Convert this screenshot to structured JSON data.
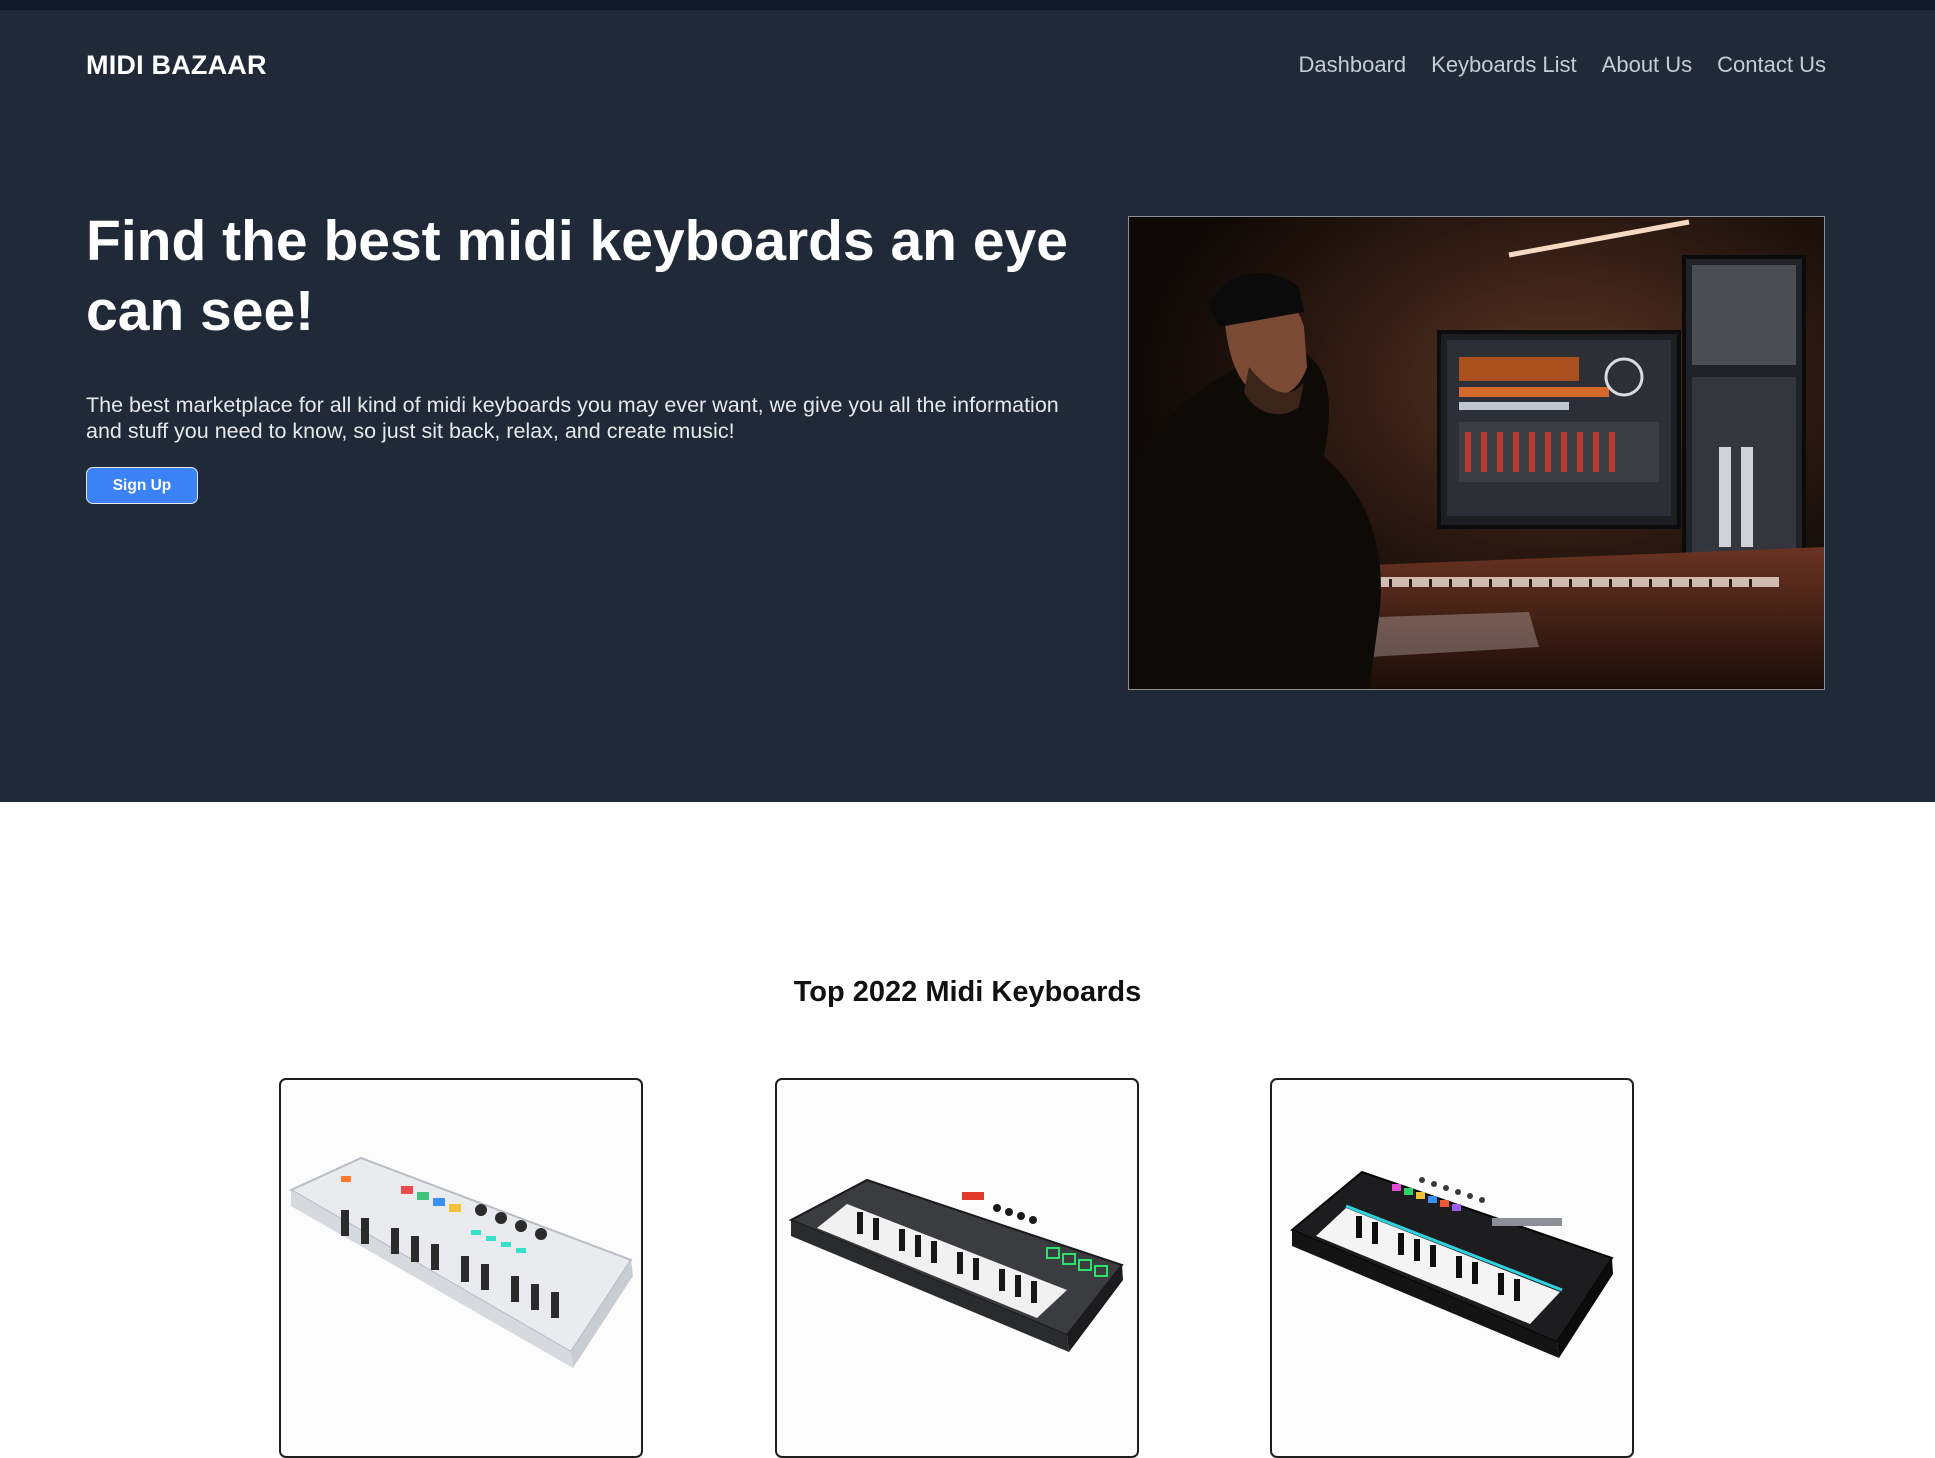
{
  "header": {
    "brand": "MIDI BAZAAR",
    "nav": [
      "Dashboard",
      "Keyboards List",
      "About Us",
      "Contact Us"
    ]
  },
  "hero": {
    "title": "Find the best midi keyboards an eye can see!",
    "text": "The best marketplace for all kind of midi keyboards you may ever want, we give you all the information and stuff you need to know, so just sit back, relax, and create music!",
    "signup_label": "Sign Up",
    "image_alt": "Music producer at a studio desk with monitors and a midi keyboard"
  },
  "section": {
    "title": "Top 2022 Midi Keyboards"
  },
  "keyboards": [
    {
      "image": "white compact midi keyboard with colorful pads"
    },
    {
      "image": "black midi keyboard with green pads"
    },
    {
      "image": "black midi keyboard with multicolor pads and light strip"
    }
  ],
  "colors": {
    "hero_bg": "#1f2937",
    "accent": "#3b82f6",
    "nav_text": "#c6cbd4"
  }
}
